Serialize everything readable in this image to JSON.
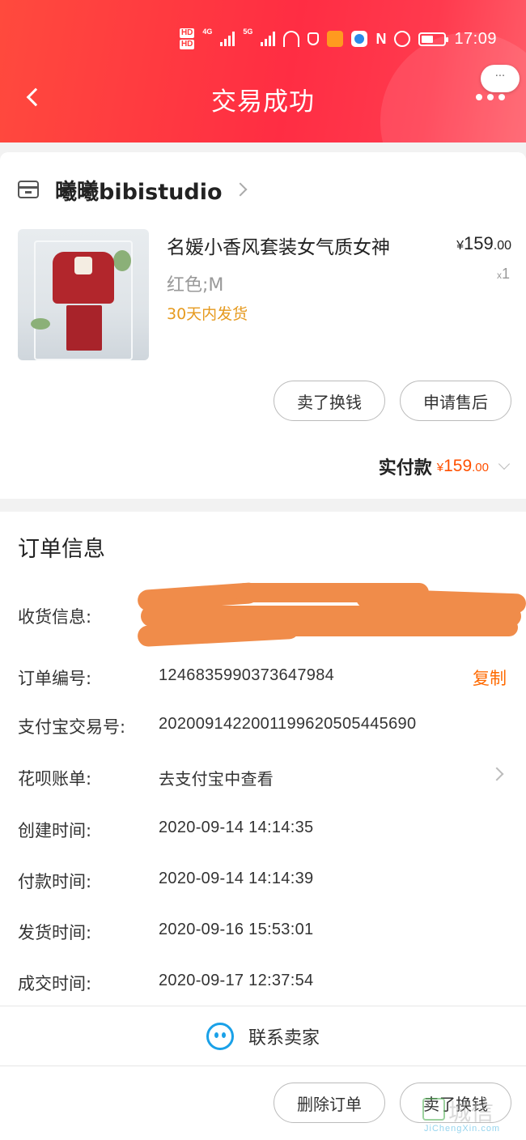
{
  "status_bar": {
    "hd1": "HD",
    "hd2": "HD",
    "net1": "4G",
    "net2": "5G",
    "time": "17:09"
  },
  "nav": {
    "title": "交易成功",
    "bubble": "···"
  },
  "shop": {
    "name": "曦曦bibistudio"
  },
  "product": {
    "title": "名媛小香风套装女气质女神",
    "price_yen": "¥",
    "price_int": "159",
    "price_cents": ".00",
    "variant": "红色;M",
    "qty_prefix": "x",
    "qty": "1",
    "ship_note": "30天内发货"
  },
  "actions": {
    "sell": "卖了换钱",
    "aftersale": "申请售后"
  },
  "payment": {
    "label": "实付款",
    "yen": "¥",
    "amount_int": "159",
    "amount_cents": ".00"
  },
  "order_info": {
    "title": "订单信息",
    "rows": [
      {
        "label": "收货信息:",
        "value": ""
      },
      {
        "label": "订单编号:",
        "value": "1246835990373647984",
        "action": "复制"
      },
      {
        "label": "支付宝交易号:",
        "value": "2020091422001199620505445690"
      },
      {
        "label": "花呗账单:",
        "value": "去支付宝中查看"
      },
      {
        "label": "创建时间:",
        "value": "2020-09-14 14:14:35"
      },
      {
        "label": "付款时间:",
        "value": "2020-09-14 14:14:39"
      },
      {
        "label": "发货时间:",
        "value": "2020-09-16 15:53:01"
      },
      {
        "label": "成交时间:",
        "value": "2020-09-17 12:37:54"
      }
    ]
  },
  "contact": {
    "label": "联系卖家"
  },
  "bottom": {
    "delete": "删除订单",
    "sell": "卖了换钱"
  },
  "watermark": {
    "big": "城信",
    "small": "JiChengXin.com"
  },
  "colors": {
    "header_red": "#ff2d43",
    "price_orange": "#ff5000",
    "ship_note": "#e69a1e",
    "copy_link": "#ff6a00",
    "contact_icon": "#1aa1e8"
  },
  "icons": [
    "back-arrow-icon",
    "more-icon",
    "store-icon",
    "chevron-right-icon",
    "chevron-down-icon",
    "contact-face-icon"
  ]
}
